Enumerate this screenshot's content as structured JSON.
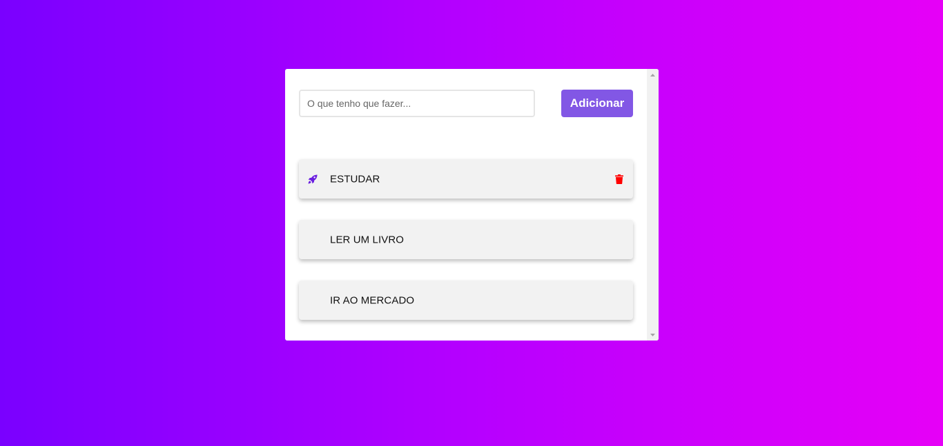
{
  "form": {
    "input_placeholder": "O que tenho que fazer...",
    "input_value": "",
    "add_label": "Adicionar"
  },
  "tasks": [
    {
      "label": "ESTUDAR",
      "icon": "rocket-icon",
      "show_delete": true
    },
    {
      "label": "LER UM LIVRO",
      "icon": null,
      "show_delete": false
    },
    {
      "label": "IR AO MERCADO",
      "icon": null,
      "show_delete": false
    }
  ],
  "colors": {
    "gradient_start": "#7a00ff",
    "gradient_end": "#e600f7",
    "accent": "#8257e5",
    "rocket": "#6a1ee0",
    "delete": "#ff0000",
    "task_bg": "#f2f2f2"
  }
}
